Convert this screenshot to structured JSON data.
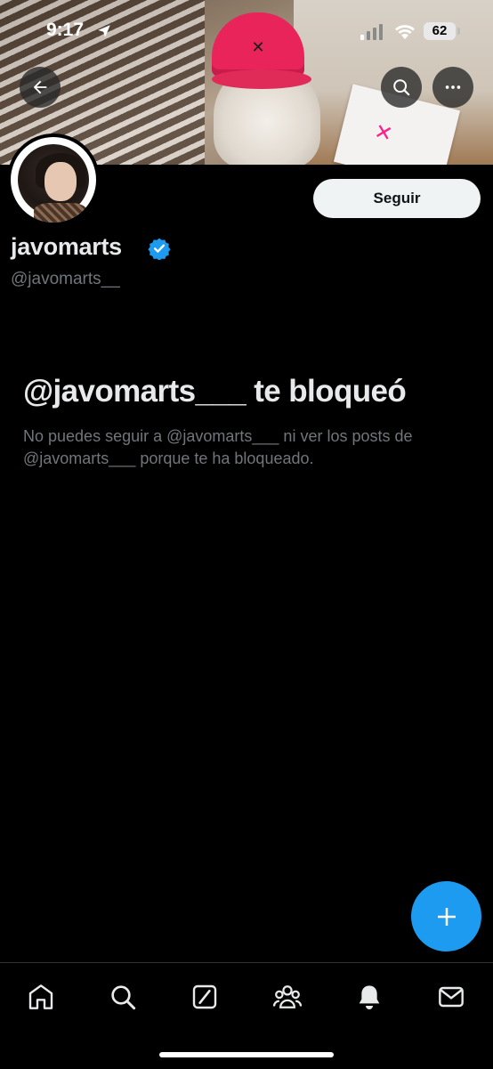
{
  "status_bar": {
    "time": "9:17",
    "battery": "62",
    "icons": [
      "location-arrow-icon",
      "signal-icon",
      "wifi-icon",
      "battery-icon"
    ]
  },
  "header": {
    "buttons": [
      "back-arrow-icon",
      "search-icon",
      "more-icon"
    ]
  },
  "profile": {
    "display_name": "javomarts",
    "username": "@javomarts__",
    "verified": true,
    "follow_label": "Seguir"
  },
  "blocked": {
    "title": "@javomarts___ te bloqueó",
    "description": "No puedes seguir a @javomarts___ ni ver los posts de @javomarts___ porque te ha bloqueado."
  },
  "bottom_nav": {
    "items": [
      "home-icon",
      "search-icon",
      "grok-icon",
      "communities-icon",
      "notifications-icon",
      "messages-icon"
    ]
  },
  "colors": {
    "accent": "#1d9bf0",
    "background": "#000000",
    "text_primary": "#e7e9ea",
    "text_secondary": "#71767b",
    "follow_button_bg": "#eff3f4"
  }
}
